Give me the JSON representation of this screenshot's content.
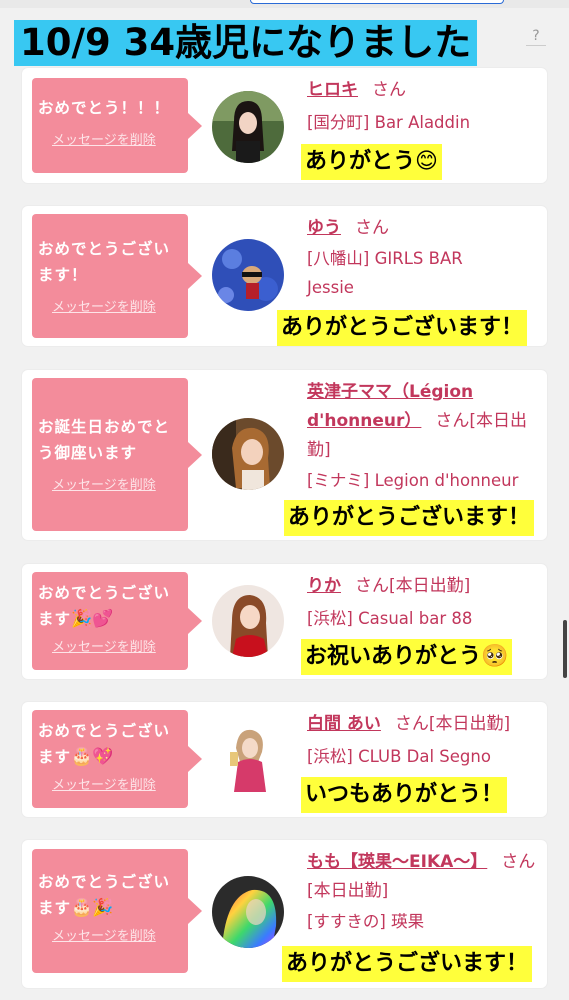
{
  "header": {
    "title": "10/9 34歳児になりました",
    "help": "?"
  },
  "delete_label": "メッセージを削除",
  "entries": [
    {
      "message": "おめでとう！！！",
      "name": "ヒロキ",
      "honorific": "さん",
      "status": "",
      "shop": "[国分町] Bar Aladdin",
      "reply": "ありがとう😊"
    },
    {
      "message": "おめでとうございます！",
      "name": "ゆう",
      "honorific": "さん",
      "status": "",
      "shop": "[八幡山] GIRLS BAR Jessie",
      "reply": "ありがとうございます！"
    },
    {
      "message": "お誕生日おめでとう御座います",
      "name": "英津子ママ（Légion d'honneur）",
      "honorific": "さん",
      "status": "[本日出勤]",
      "shop": "[ミナミ] Legion d'honneur",
      "reply": "ありがとうございます！"
    },
    {
      "message": "おめでとうございます",
      "message_emoji": "🎉💕",
      "name": "りか",
      "honorific": "さん",
      "status": "[本日出勤]",
      "shop": "[浜松] Casual bar 88",
      "reply": "お祝いありがとう🥺"
    },
    {
      "message": "おめでとうございます",
      "message_emoji": "🎂💖",
      "name": "白間 あい",
      "honorific": "さん",
      "status": "[本日出勤]",
      "shop": "[浜松] CLUB Dal Segno",
      "reply": "いつもありがとう！"
    },
    {
      "message": "おめでとうございます",
      "message_emoji": "🎂🎉",
      "name": "もも【瑛果〜EIKA〜】",
      "honorific": "さん",
      "status": "[本日出勤]",
      "shop": "[すすきの] 瑛果",
      "reply": "ありがとうございます！"
    }
  ],
  "colors": {
    "headline_bg": "#38c8f2",
    "bubble_bg": "#f38c9b",
    "link": "#c2375c",
    "reply_highlight": "#ffff3b"
  }
}
